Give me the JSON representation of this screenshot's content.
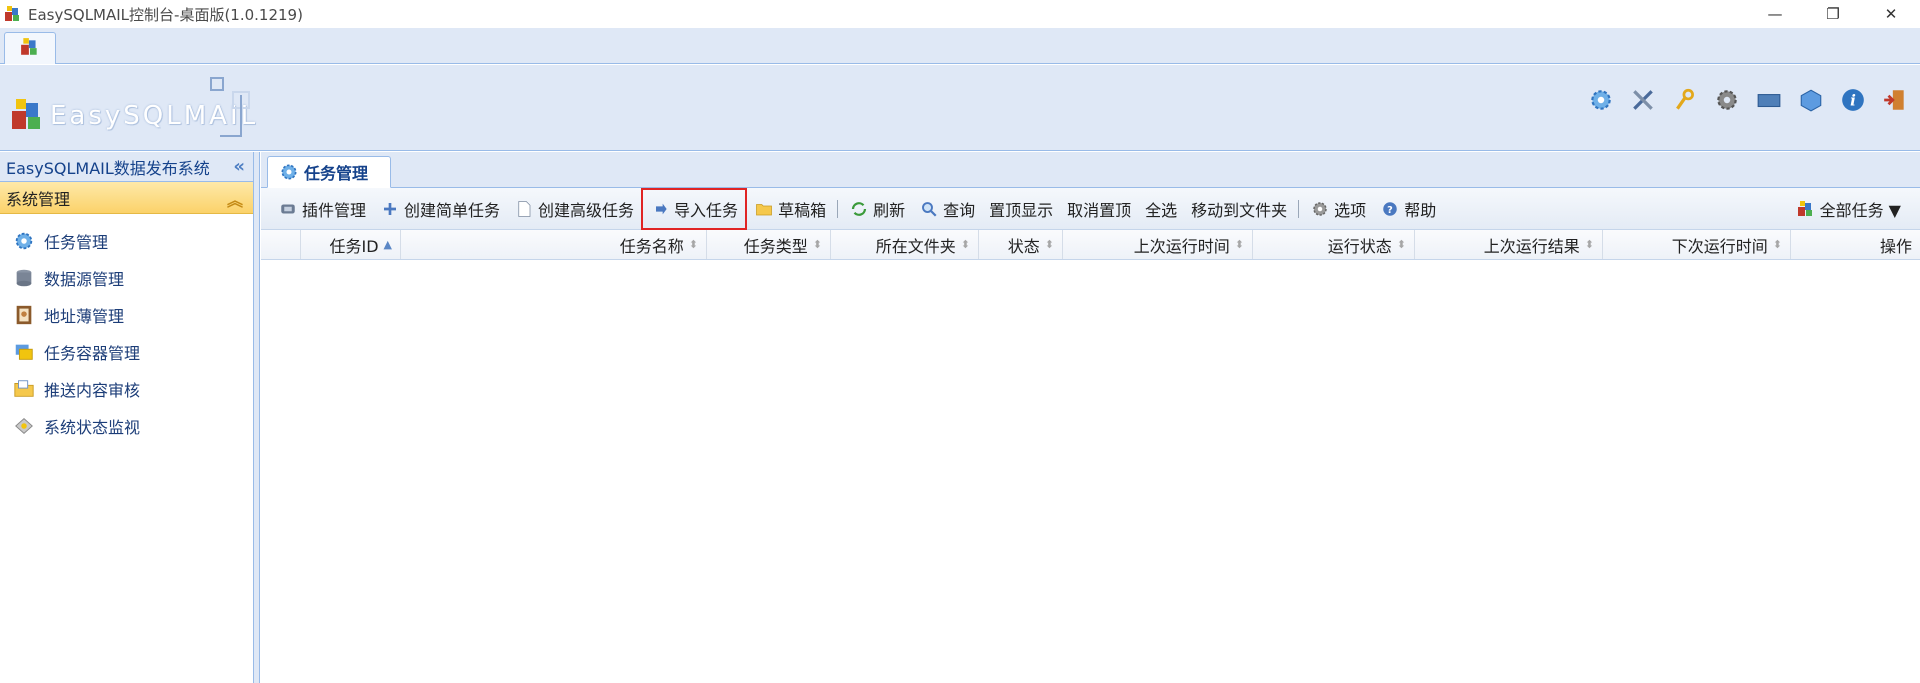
{
  "window": {
    "title": "EasySQLMAIL控制台-桌面版(1.0.1219)",
    "controls": [
      "—",
      "❐",
      "✕"
    ]
  },
  "logo": {
    "text": "EasySQLMAIL"
  },
  "header_icons": [
    "settings-gear-icon",
    "tools-icon",
    "key-icon",
    "cog-icon",
    "monitor-icon",
    "cube-icon",
    "info-icon",
    "exit-icon"
  ],
  "sidebar": {
    "title": "EasySQLMAIL数据发布系统",
    "section": "系统管理",
    "items": [
      {
        "label": "任务管理",
        "icon": "gear-icon"
      },
      {
        "label": "数据源管理",
        "icon": "database-icon"
      },
      {
        "label": "地址薄管理",
        "icon": "address-book-icon"
      },
      {
        "label": "任务容器管理",
        "icon": "container-icon"
      },
      {
        "label": "推送内容审核",
        "icon": "folder-icon"
      },
      {
        "label": "系统状态监视",
        "icon": "monitor-icon"
      }
    ]
  },
  "main": {
    "tab": "任务管理",
    "toolbar": {
      "plugins": "插件管理",
      "create_simple": "创建简单任务",
      "create_advanced": "创建高级任务",
      "import": "导入任务",
      "drafts": "草稿箱",
      "refresh": "刷新",
      "query": "查询",
      "pin_top": "置顶显示",
      "unpin": "取消置顶",
      "select_all": "全选",
      "move_folder": "移动到文件夹",
      "options": "选项",
      "help": "帮助",
      "all_tasks": "全部任务 ▼"
    },
    "columns": [
      {
        "label": "任务ID",
        "sort": "asc"
      },
      {
        "label": "任务名称",
        "sort": "none"
      },
      {
        "label": "任务类型",
        "sort": "none"
      },
      {
        "label": "所在文件夹",
        "sort": "none"
      },
      {
        "label": "状态",
        "sort": "none"
      },
      {
        "label": "上次运行时间",
        "sort": "none"
      },
      {
        "label": "运行状态",
        "sort": "none"
      },
      {
        "label": "上次运行结果",
        "sort": "none"
      },
      {
        "label": "下次运行时间",
        "sort": "none"
      },
      {
        "label": "操作",
        "sort": "none"
      }
    ],
    "rows": []
  },
  "colors": {
    "accent": "#15428b",
    "panel": "#dfe8f6",
    "border": "#99bbe8",
    "section": "#fbd26a",
    "highlight": "#e02424"
  }
}
